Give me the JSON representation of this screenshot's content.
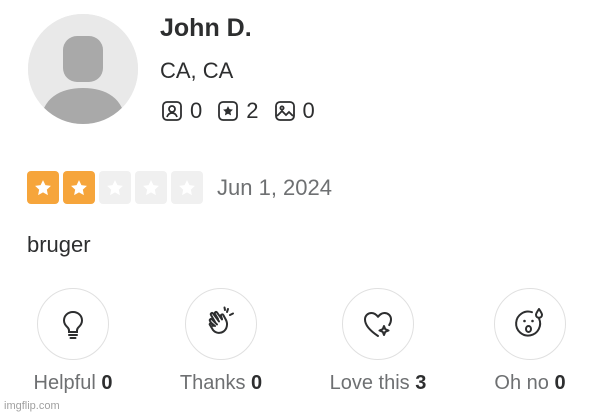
{
  "user": {
    "name": "John D.",
    "location": "CA, CA",
    "stats": [
      {
        "icon": "friends-icon",
        "value": "0"
      },
      {
        "icon": "reviews-star-icon",
        "value": "2"
      },
      {
        "icon": "photos-icon",
        "value": "0"
      }
    ]
  },
  "review": {
    "rating": 2,
    "max_rating": 5,
    "date": "Jun 1, 2024",
    "text": "bruger"
  },
  "reactions": [
    {
      "icon": "lightbulb-icon",
      "label": "Helpful",
      "count": "0"
    },
    {
      "icon": "clapping-hands-icon",
      "label": "Thanks",
      "count": "0"
    },
    {
      "icon": "heart-sparkle-icon",
      "label": "Love this",
      "count": "3"
    },
    {
      "icon": "surprised-face-icon",
      "label": "Oh no",
      "count": "0"
    }
  ],
  "colors": {
    "star_filled": "#f6a53b",
    "star_empty": "#f0f0f0",
    "text_primary": "#2d2e2f",
    "text_secondary": "#6e7072"
  },
  "watermark": "imgflip.com"
}
